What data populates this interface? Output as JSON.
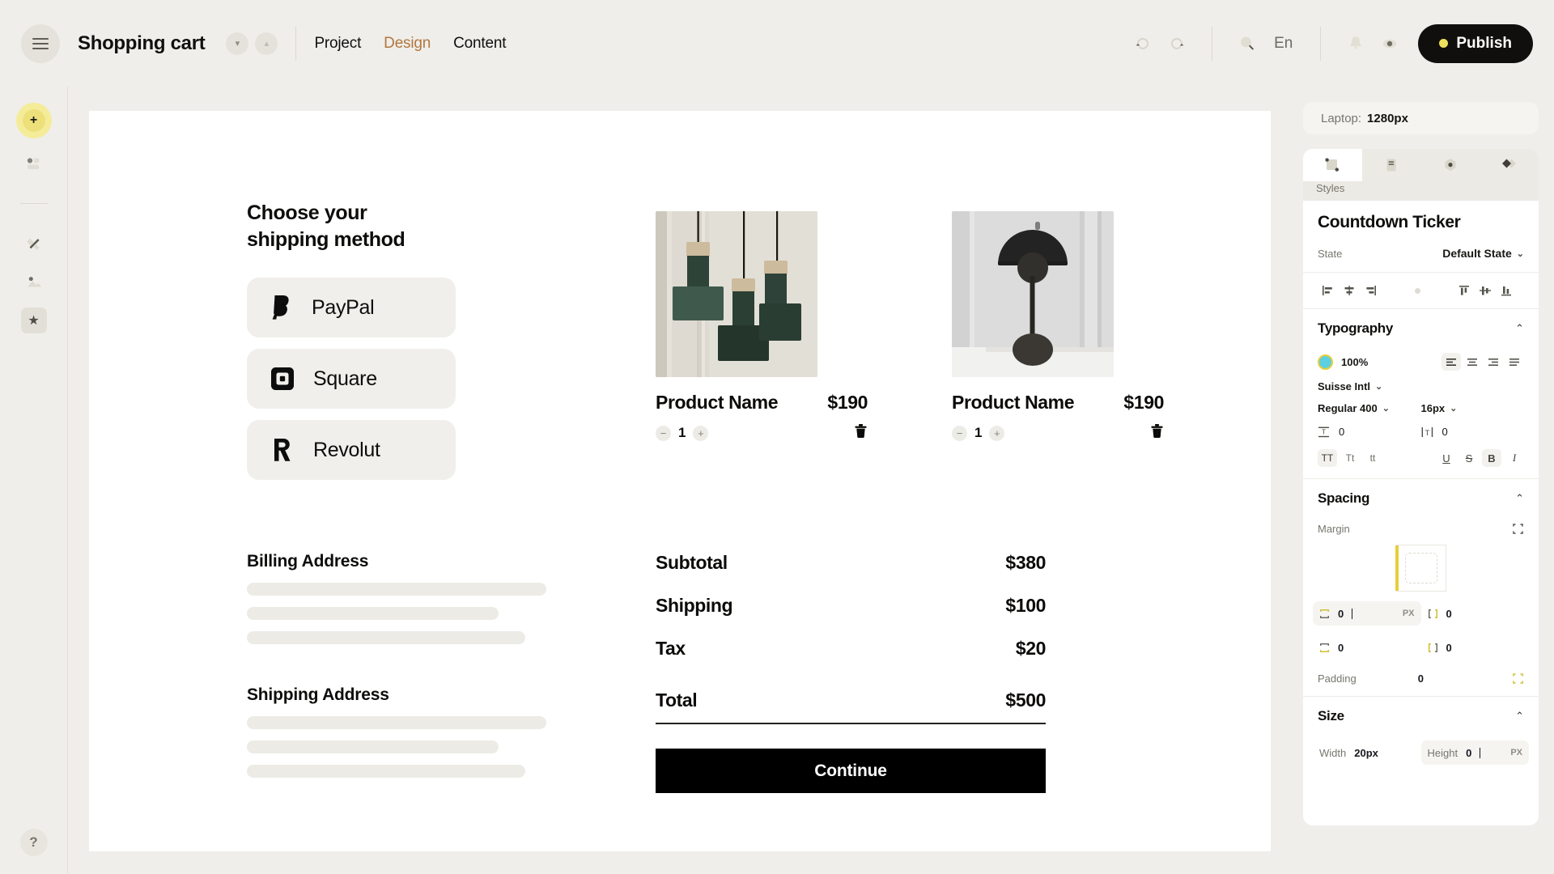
{
  "topbar": {
    "menu_icon": "hamburger-icon",
    "document_title": "Shopping cart",
    "chip_down_icon": "chevron-down-icon",
    "chip_up_icon": "chevron-up-icon",
    "tabs": [
      {
        "label": "Project",
        "active": false
      },
      {
        "label": "Design",
        "active": true
      },
      {
        "label": "Content",
        "active": false
      }
    ],
    "undo_icon": "undo-icon",
    "redo_icon": "redo-icon",
    "search_icon": "search-icon",
    "language": "En",
    "bell_icon": "bell-icon",
    "preview_icon": "eye-icon",
    "publish_label": "Publish",
    "publish_bg": "#100f0d",
    "publish_dot_color": "#ece05d",
    "active_tab_color": "#b3773f"
  },
  "leftrail": {
    "add_icon": "plus-icon",
    "layers_icon": "layers-icon",
    "assets_icon": "pen-ruler-icon",
    "media_icon": "image-icon",
    "favorites_icon": "star-icon",
    "help_label": "?"
  },
  "canvas": {
    "shipping": {
      "heading_line1": "Choose your",
      "heading_line2": "shipping method",
      "methods": [
        {
          "label": "PayPal",
          "icon": "paypal-icon"
        },
        {
          "label": "Square",
          "icon": "square-icon"
        },
        {
          "label": "Revolut",
          "icon": "revolut-icon"
        }
      ]
    },
    "billing": {
      "title": "Billing Address",
      "placeholder_widths": [
        "100%",
        "84%",
        "93%"
      ]
    },
    "shipping_address": {
      "title": "Shipping Address",
      "placeholder_widths": [
        "100%",
        "84%",
        "93%"
      ]
    },
    "products": [
      {
        "image": "pendant-lamps-photo",
        "name": "Product Name",
        "price": "$190",
        "quantity": "1",
        "decrease_icon": "minus-icon",
        "increase_icon": "plus-icon",
        "delete_icon": "trash-icon"
      },
      {
        "image": "dome-table-lamp-photo",
        "name": "Product Name",
        "price": "$190",
        "quantity": "1",
        "decrease_icon": "minus-icon",
        "increase_icon": "plus-icon",
        "delete_icon": "trash-icon"
      }
    ],
    "summary": {
      "rows": [
        {
          "label": "Subtotal",
          "value": "$380"
        },
        {
          "label": "Shipping",
          "value": "$100"
        },
        {
          "label": "Tax",
          "value": "$20"
        },
        {
          "label": "Total",
          "value": "$500"
        }
      ],
      "continue_label": "Continue"
    }
  },
  "rightpanel": {
    "viewport_label": "Laptop:",
    "viewport_value": "1280px",
    "tabs": [
      {
        "icon": "selection-node-icon",
        "active": true
      },
      {
        "icon": "page-settings-icon",
        "active": false
      },
      {
        "icon": "component-hexagon-icon",
        "active": false
      },
      {
        "icon": "interactions-diamond-icon",
        "active": false
      }
    ],
    "styles_label": "Styles",
    "component_name": "Countdown Ticker",
    "state_label": "State",
    "state_value": "Default State",
    "align_icons": [
      "align-left-icon",
      "align-center-horizontal-icon",
      "align-right-icon",
      "distribute-dot-icon",
      "align-top-icon",
      "align-middle-vertical-icon",
      "align-bottom-icon"
    ],
    "typography": {
      "title": "Typography",
      "collapse_icon": "chevron-up-icon",
      "color_swatch": "#5ecfe0",
      "opacity": "100%",
      "align_options": [
        "text-align-left-icon",
        "text-align-center-icon",
        "text-align-right-icon",
        "text-align-justify-icon"
      ],
      "align_selected": 0,
      "font_family": "Suisse Intl",
      "font_weight": "Regular 400",
      "font_size": "16px",
      "line_height_icon": "line-height-icon",
      "line_height": "0",
      "letter_spacing_icon": "letter-spacing-icon",
      "letter_spacing": "0",
      "case_options": [
        "TT",
        "Tt",
        "tt"
      ],
      "case_selected": 0,
      "decoration_options": [
        "U",
        "S",
        "B",
        "I"
      ],
      "decoration_selected": 2
    },
    "spacing": {
      "title": "Spacing",
      "collapse_icon": "chevron-up-icon",
      "margin_label": "Margin",
      "margin_link_icon": "link-all-sides-icon",
      "margin_top": "0",
      "margin_top_unit": "PX",
      "margin_right": "0",
      "margin_bottom": "0",
      "margin_left": "0",
      "padding_label": "Padding",
      "padding_value": "0",
      "padding_link_icon": "link-all-sides-icon"
    },
    "size": {
      "title": "Size",
      "collapse_icon": "chevron-up-icon",
      "width_label": "Width",
      "width_value": "20px",
      "height_label": "Height",
      "height_value": "0",
      "height_unit": "PX"
    }
  }
}
